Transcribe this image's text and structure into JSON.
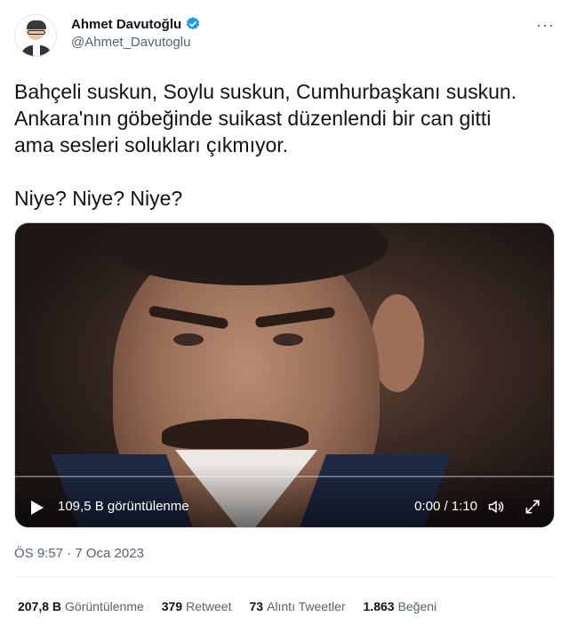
{
  "author": {
    "display_name": "Ahmet Davutoğlu",
    "handle": "@Ahmet_Davutoglu"
  },
  "more_label": "···",
  "tweet": {
    "lines": [
      "Bahçeli suskun, Soylu suskun, Cumhurbaşkanı suskun.",
      "Ankara'nın göbeğinde suikast düzenlendi bir can gitti",
      "ama sesleri solukları çıkmıyor."
    ],
    "closing": "Niye? Niye? Niye?"
  },
  "video": {
    "views_label": "109,5 B görüntülenme",
    "time_label": "0:00 / 1:10",
    "progress_fraction": 0.0
  },
  "timestamp": "ÖS 9:57 · 7 Oca 2023",
  "stats": {
    "views_value": "207,8 B",
    "views_label": "Görüntülenme",
    "retweets_value": "379",
    "retweets_label": "Retweet",
    "quotes_value": "73",
    "quotes_label": "Alıntı Tweetler",
    "likes_value": "1.863",
    "likes_label": "Beğeni"
  },
  "colors": {
    "verified_blue": "#1d9bf0",
    "text_primary": "#0f1419",
    "text_secondary": "#536471"
  },
  "icons": [
    "verified-badge-icon",
    "more-icon",
    "play-icon",
    "volume-icon",
    "expand-icon"
  ]
}
